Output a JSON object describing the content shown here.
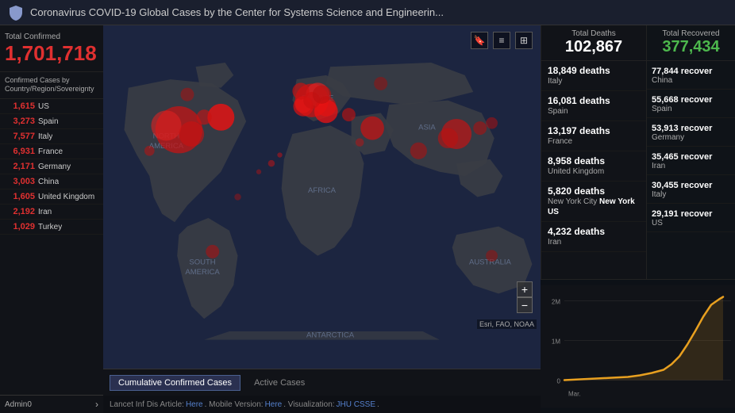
{
  "header": {
    "title": "Coronavirus COVID-19 Global Cases by the Center for Systems Science and Engineerin...",
    "shield_icon": "shield"
  },
  "sidebar": {
    "total_confirmed_label": "Total Confirmed",
    "total_confirmed_value": "1,701,718",
    "confirmed_cases_label": "Confirmed Cases by Country/Region/Sovereignty",
    "countries": [
      {
        "count": "1,615",
        "name": "US"
      },
      {
        "count": "3,273",
        "name": "Spain"
      },
      {
        "count": "7,577",
        "name": "Italy"
      },
      {
        "count": "6,931",
        "name": "France"
      },
      {
        "count": "2,171",
        "name": "Germany"
      },
      {
        "count": "3,003",
        "name": "China"
      },
      {
        "count": "1,605",
        "name": "United Kingdom"
      },
      {
        "count": "2,192",
        "name": "Iran"
      },
      {
        "count": "1,029",
        "name": "Turkey"
      }
    ],
    "admin_label": "Admin0",
    "arrow": "›"
  },
  "map": {
    "toolbar_buttons": [
      "bookmark",
      "list",
      "grid"
    ],
    "zoom_in": "+",
    "zoom_out": "−",
    "esri_credit": "Esri, FAO, NOAA",
    "tabs": [
      {
        "label": "Cumulative Confirmed Cases",
        "active": true
      },
      {
        "label": "Active Cases",
        "active": false
      }
    ],
    "footer": "Lancet Inf Dis Article: Here. Mobile Version: Here. Visualization: JHU CSSE."
  },
  "deaths": {
    "panel_label": "Total Deaths",
    "total": "102,867",
    "items": [
      {
        "count": "18,849",
        "label": "deaths",
        "location": "Italy"
      },
      {
        "count": "16,081",
        "label": "deaths",
        "location": "Spain"
      },
      {
        "count": "13,197",
        "label": "deaths",
        "location": "France"
      },
      {
        "count": "8,958",
        "label": "deaths",
        "location": "United Kingdom"
      },
      {
        "count": "5,820",
        "label": "deaths",
        "location": "New York City",
        "extra": "New York US"
      },
      {
        "count": "4,232",
        "label": "deaths",
        "location": "Iran"
      }
    ]
  },
  "recovered": {
    "panel_label": "Total Recovered",
    "total": "377,434",
    "items": [
      {
        "count": "77,844",
        "label": "recover",
        "location": "China"
      },
      {
        "count": "55,668",
        "label": "recover",
        "location": "Spain"
      },
      {
        "count": "53,913",
        "label": "recover",
        "location": "Germany"
      },
      {
        "count": "35,465",
        "label": "recover",
        "location": "Iran"
      },
      {
        "count": "30,455",
        "label": "recover",
        "location": "Italy"
      },
      {
        "count": "29,191",
        "label": "recover",
        "location": "US"
      }
    ]
  },
  "chart": {
    "y_labels": [
      "2M",
      "1M",
      "0"
    ],
    "x_label": "Mar.",
    "line_color": "#e8a020"
  },
  "colors": {
    "background": "#0d1117",
    "sidebar_bg": "#111318",
    "header_bg": "#1a1f2e",
    "confirmed_red": "#e03030",
    "deaths_white": "#ffffff",
    "recovered_green": "#4db84d",
    "map_bg": "#1c2540",
    "land": "#3a3a3a",
    "ocean": "#1c2540"
  }
}
